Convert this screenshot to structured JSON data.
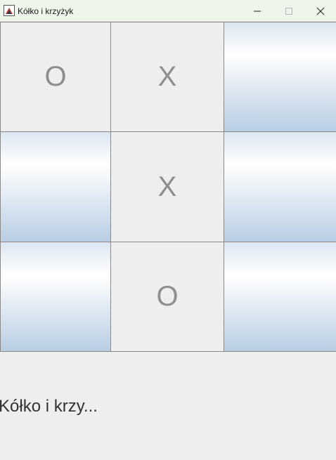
{
  "window": {
    "title": "Kółko i krzyżyk"
  },
  "title_buttons": {
    "minimize_icon": "minimize-icon",
    "maximize_icon": "maximize-icon",
    "close_icon": "close-icon"
  },
  "board": {
    "cells": [
      "O",
      "X",
      "",
      "",
      "X",
      "",
      "",
      "O",
      ""
    ]
  },
  "status": {
    "text": "Kółko i krzy..."
  },
  "colors": {
    "titlebar": "#eef5ea",
    "mark": "#8f8f8f",
    "played_cell": "#eeeeee",
    "empty_cell_gradient_mid": "#ffffff",
    "empty_cell_gradient_edge": "#b8cde3"
  }
}
